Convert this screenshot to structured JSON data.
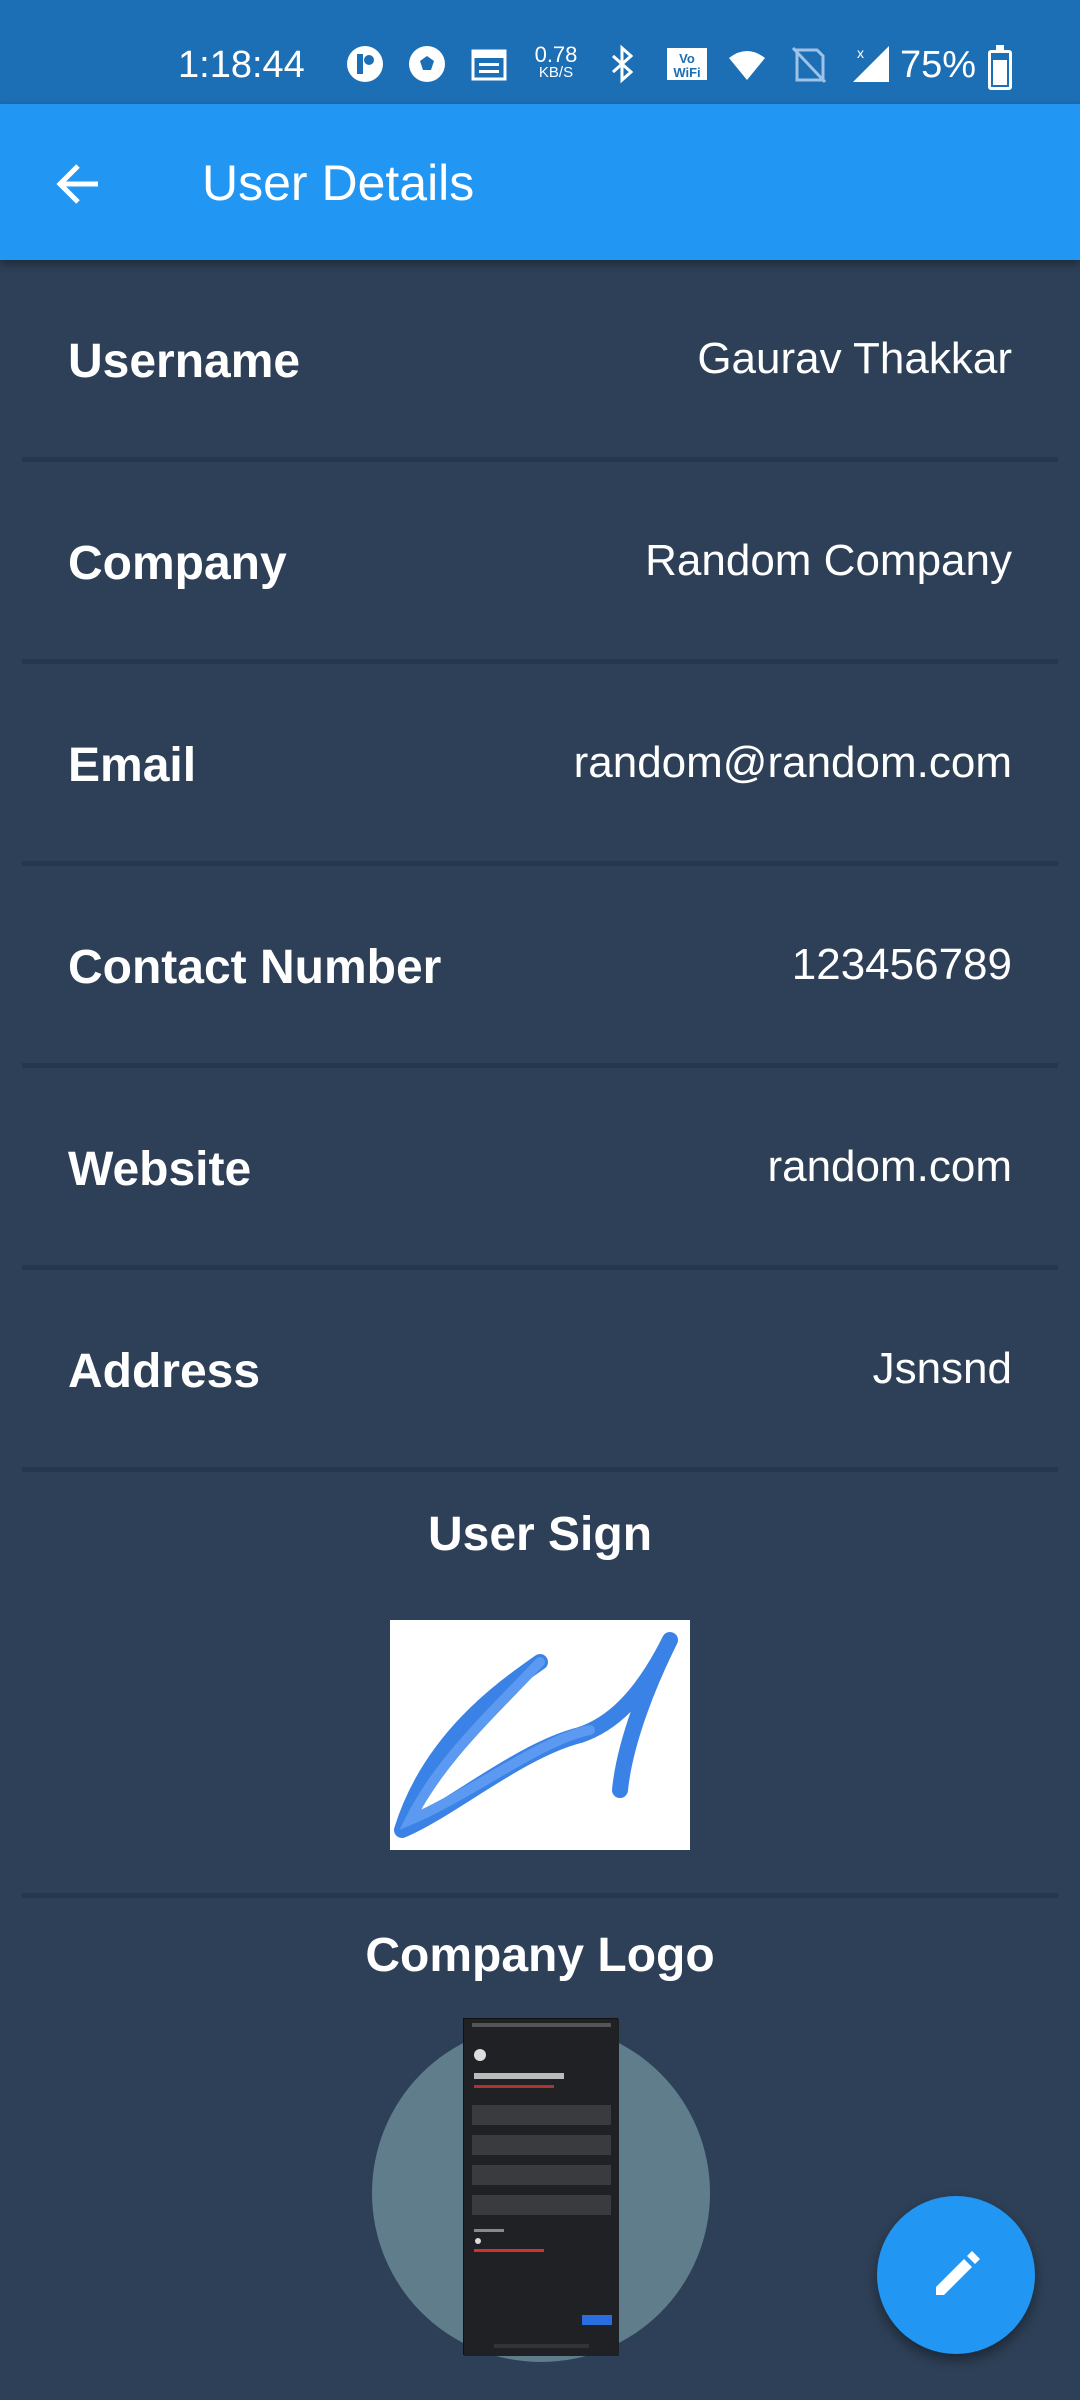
{
  "status_bar": {
    "time": "1:18:44",
    "net_speed_value": "0.78",
    "net_speed_unit": "KB/S",
    "battery_percent": "75%",
    "icons": [
      "app-icon",
      "football-icon",
      "calendar-icon",
      "bluetooth-icon",
      "vowifi-icon",
      "wifi-icon",
      "no-sim-icon",
      "signal-icon",
      "battery-charging-icon"
    ]
  },
  "app_bar": {
    "title": "User Details",
    "back_icon": "arrow-back-icon"
  },
  "details": [
    {
      "label": "Username",
      "value": "Gaurav Thakkar"
    },
    {
      "label": "Company",
      "value": "Random Company"
    },
    {
      "label": "Email",
      "value": "random@random.com"
    },
    {
      "label": "Contact Number",
      "value": "123456789"
    },
    {
      "label": "Website",
      "value": "random.com"
    },
    {
      "label": "Address",
      "value": "Jsnsnd"
    }
  ],
  "sign_section": {
    "title": "User Sign"
  },
  "logo_section": {
    "title": "Company Logo"
  },
  "fab": {
    "icon": "edit-pencil-icon"
  },
  "colors": {
    "status_bar": "#1c6eb5",
    "app_bar": "#2196f3",
    "background": "#2e4057",
    "divider": "#25374c",
    "signature_stroke": "#3b82e6",
    "logo_circle": "#5f7d8b"
  }
}
